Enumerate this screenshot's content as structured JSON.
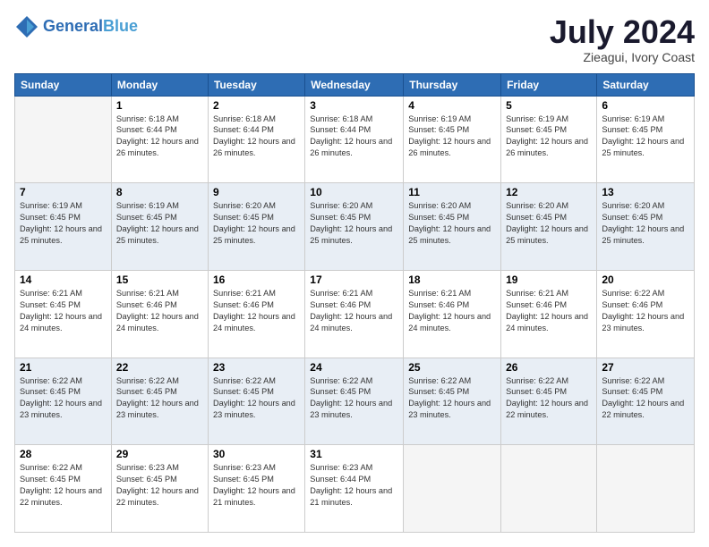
{
  "header": {
    "logo_line1": "General",
    "logo_line2": "Blue",
    "month": "July 2024",
    "location": "Zieagui, Ivory Coast"
  },
  "days_of_week": [
    "Sunday",
    "Monday",
    "Tuesday",
    "Wednesday",
    "Thursday",
    "Friday",
    "Saturday"
  ],
  "weeks": [
    [
      {
        "day": "",
        "sunrise": "",
        "sunset": "",
        "daylight": ""
      },
      {
        "day": "1",
        "sunrise": "Sunrise: 6:18 AM",
        "sunset": "Sunset: 6:44 PM",
        "daylight": "Daylight: 12 hours and 26 minutes."
      },
      {
        "day": "2",
        "sunrise": "Sunrise: 6:18 AM",
        "sunset": "Sunset: 6:44 PM",
        "daylight": "Daylight: 12 hours and 26 minutes."
      },
      {
        "day": "3",
        "sunrise": "Sunrise: 6:18 AM",
        "sunset": "Sunset: 6:44 PM",
        "daylight": "Daylight: 12 hours and 26 minutes."
      },
      {
        "day": "4",
        "sunrise": "Sunrise: 6:19 AM",
        "sunset": "Sunset: 6:45 PM",
        "daylight": "Daylight: 12 hours and 26 minutes."
      },
      {
        "day": "5",
        "sunrise": "Sunrise: 6:19 AM",
        "sunset": "Sunset: 6:45 PM",
        "daylight": "Daylight: 12 hours and 26 minutes."
      },
      {
        "day": "6",
        "sunrise": "Sunrise: 6:19 AM",
        "sunset": "Sunset: 6:45 PM",
        "daylight": "Daylight: 12 hours and 25 minutes."
      }
    ],
    [
      {
        "day": "7",
        "sunrise": "Sunrise: 6:19 AM",
        "sunset": "Sunset: 6:45 PM",
        "daylight": "Daylight: 12 hours and 25 minutes."
      },
      {
        "day": "8",
        "sunrise": "Sunrise: 6:19 AM",
        "sunset": "Sunset: 6:45 PM",
        "daylight": "Daylight: 12 hours and 25 minutes."
      },
      {
        "day": "9",
        "sunrise": "Sunrise: 6:20 AM",
        "sunset": "Sunset: 6:45 PM",
        "daylight": "Daylight: 12 hours and 25 minutes."
      },
      {
        "day": "10",
        "sunrise": "Sunrise: 6:20 AM",
        "sunset": "Sunset: 6:45 PM",
        "daylight": "Daylight: 12 hours and 25 minutes."
      },
      {
        "day": "11",
        "sunrise": "Sunrise: 6:20 AM",
        "sunset": "Sunset: 6:45 PM",
        "daylight": "Daylight: 12 hours and 25 minutes."
      },
      {
        "day": "12",
        "sunrise": "Sunrise: 6:20 AM",
        "sunset": "Sunset: 6:45 PM",
        "daylight": "Daylight: 12 hours and 25 minutes."
      },
      {
        "day": "13",
        "sunrise": "Sunrise: 6:20 AM",
        "sunset": "Sunset: 6:45 PM",
        "daylight": "Daylight: 12 hours and 25 minutes."
      }
    ],
    [
      {
        "day": "14",
        "sunrise": "Sunrise: 6:21 AM",
        "sunset": "Sunset: 6:45 PM",
        "daylight": "Daylight: 12 hours and 24 minutes."
      },
      {
        "day": "15",
        "sunrise": "Sunrise: 6:21 AM",
        "sunset": "Sunset: 6:46 PM",
        "daylight": "Daylight: 12 hours and 24 minutes."
      },
      {
        "day": "16",
        "sunrise": "Sunrise: 6:21 AM",
        "sunset": "Sunset: 6:46 PM",
        "daylight": "Daylight: 12 hours and 24 minutes."
      },
      {
        "day": "17",
        "sunrise": "Sunrise: 6:21 AM",
        "sunset": "Sunset: 6:46 PM",
        "daylight": "Daylight: 12 hours and 24 minutes."
      },
      {
        "day": "18",
        "sunrise": "Sunrise: 6:21 AM",
        "sunset": "Sunset: 6:46 PM",
        "daylight": "Daylight: 12 hours and 24 minutes."
      },
      {
        "day": "19",
        "sunrise": "Sunrise: 6:21 AM",
        "sunset": "Sunset: 6:46 PM",
        "daylight": "Daylight: 12 hours and 24 minutes."
      },
      {
        "day": "20",
        "sunrise": "Sunrise: 6:22 AM",
        "sunset": "Sunset: 6:46 PM",
        "daylight": "Daylight: 12 hours and 23 minutes."
      }
    ],
    [
      {
        "day": "21",
        "sunrise": "Sunrise: 6:22 AM",
        "sunset": "Sunset: 6:45 PM",
        "daylight": "Daylight: 12 hours and 23 minutes."
      },
      {
        "day": "22",
        "sunrise": "Sunrise: 6:22 AM",
        "sunset": "Sunset: 6:45 PM",
        "daylight": "Daylight: 12 hours and 23 minutes."
      },
      {
        "day": "23",
        "sunrise": "Sunrise: 6:22 AM",
        "sunset": "Sunset: 6:45 PM",
        "daylight": "Daylight: 12 hours and 23 minutes."
      },
      {
        "day": "24",
        "sunrise": "Sunrise: 6:22 AM",
        "sunset": "Sunset: 6:45 PM",
        "daylight": "Daylight: 12 hours and 23 minutes."
      },
      {
        "day": "25",
        "sunrise": "Sunrise: 6:22 AM",
        "sunset": "Sunset: 6:45 PM",
        "daylight": "Daylight: 12 hours and 23 minutes."
      },
      {
        "day": "26",
        "sunrise": "Sunrise: 6:22 AM",
        "sunset": "Sunset: 6:45 PM",
        "daylight": "Daylight: 12 hours and 22 minutes."
      },
      {
        "day": "27",
        "sunrise": "Sunrise: 6:22 AM",
        "sunset": "Sunset: 6:45 PM",
        "daylight": "Daylight: 12 hours and 22 minutes."
      }
    ],
    [
      {
        "day": "28",
        "sunrise": "Sunrise: 6:22 AM",
        "sunset": "Sunset: 6:45 PM",
        "daylight": "Daylight: 12 hours and 22 minutes."
      },
      {
        "day": "29",
        "sunrise": "Sunrise: 6:23 AM",
        "sunset": "Sunset: 6:45 PM",
        "daylight": "Daylight: 12 hours and 22 minutes."
      },
      {
        "day": "30",
        "sunrise": "Sunrise: 6:23 AM",
        "sunset": "Sunset: 6:45 PM",
        "daylight": "Daylight: 12 hours and 21 minutes."
      },
      {
        "day": "31",
        "sunrise": "Sunrise: 6:23 AM",
        "sunset": "Sunset: 6:44 PM",
        "daylight": "Daylight: 12 hours and 21 minutes."
      },
      {
        "day": "",
        "sunrise": "",
        "sunset": "",
        "daylight": ""
      },
      {
        "day": "",
        "sunrise": "",
        "sunset": "",
        "daylight": ""
      },
      {
        "day": "",
        "sunrise": "",
        "sunset": "",
        "daylight": ""
      }
    ]
  ]
}
